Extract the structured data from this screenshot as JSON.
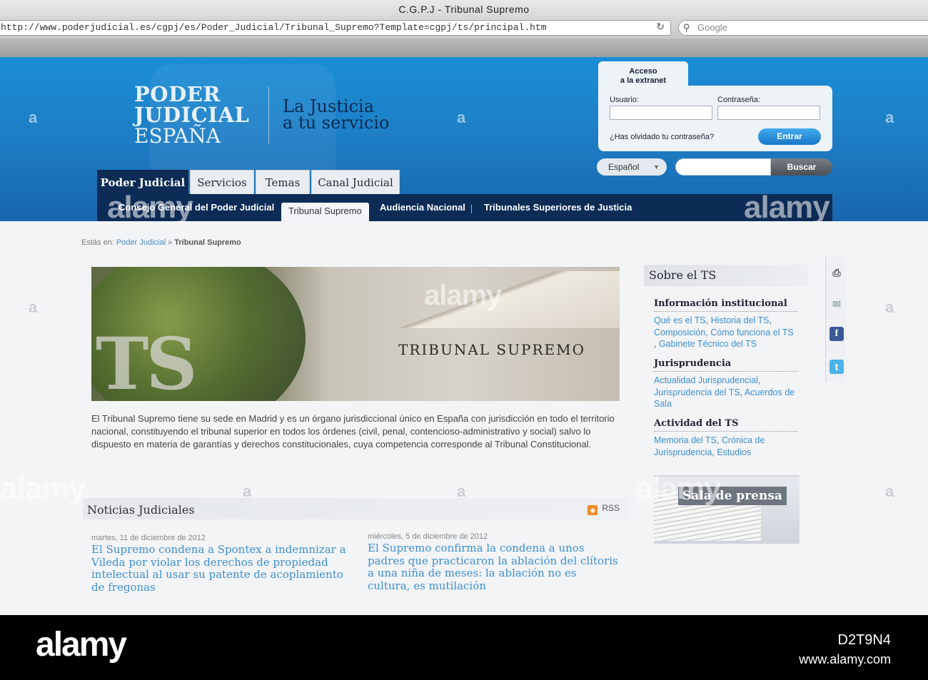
{
  "browser": {
    "window_title": "C.G.P.J - Tribunal Supremo",
    "url": "http://www.poderjudicial.es/cgpj/es/Poder_Judicial/Tribunal_Supremo?Template=cgpj/ts/principal.htm",
    "search_placeholder": "Google"
  },
  "header": {
    "logo_line1": "PODER",
    "logo_line2": "JUDICIAL",
    "logo_line3": "ESPAÑA",
    "tagline_line1": "La Justicia",
    "tagline_line2": "a tu servicio"
  },
  "login": {
    "tab_line1": "Acceso",
    "tab_line2": "a la extranet",
    "user_label": "Usuario:",
    "password_label": "Contraseña:",
    "forgot": "¿Has olvidado tu contraseña?",
    "submit": "Entrar"
  },
  "site_search": {
    "language": "Español",
    "button": "Buscar"
  },
  "main_tabs": [
    "Poder Judicial",
    "Servicios",
    "Temas",
    "Canal Judicial"
  ],
  "sub_nav": [
    "Consejo General del Poder Judicial",
    "Tribunal Supremo",
    "Audiencia Nacional",
    "Tribunales Superiores de Justicia"
  ],
  "breadcrumb": {
    "prefix": "Estás en:",
    "link": "Poder Judicial",
    "separator": "»",
    "current": "Tribunal Supremo"
  },
  "hero": {
    "inscription": "TRIBUNAL SUPREMO",
    "overlay": "TS"
  },
  "intro_text": "El Tribunal Supremo tiene su sede en Madrid  y es un órgano jurisdiccional único en España con jurisdicción en todo el territorio nacional, constituyendo el tribunal superior en todos los órdenes (civil, penal, contencioso-administrativo y social) salvo lo dispuesto en materia de garantías y derechos constitucionales, cuya competencia corresponde al Tribunal Constitucional.",
  "news": {
    "title": "Noticias Judiciales",
    "rss": "RSS",
    "items": [
      {
        "date": "martes, 11 de diciembre de 2012",
        "headline": "El Supremo condena a Spontex a indemnizar a Vileda por violar los derechos de propiedad intelectual al usar su patente de acoplamiento de fregonas"
      },
      {
        "date": "miércoles, 5 de diciembre de 2012",
        "headline": "El Supremo confirma la condena a unos padres que practicaron la ablación del clítoris a una niña de meses: la ablación no es cultura, es mutilación"
      }
    ]
  },
  "sidebar": {
    "title": "Sobre el TS",
    "sections": [
      {
        "title": "Información institucional",
        "links": [
          "Qué es el TS",
          "Historia del TS",
          "Composición",
          "Cómo funciona el TS",
          "Gabinete Técnico del TS"
        ]
      },
      {
        "title": "Jurisprudencia",
        "links": [
          "Actualidad Jurisprudencial",
          "Jurisprudencia del TS",
          "Acuerdos de Sala"
        ]
      },
      {
        "title": "Actividad del TS",
        "links": [
          "Memoria del TS",
          "Crónica de Jurisprudencia",
          "Estudios"
        ]
      }
    ],
    "press_room": "Sala de prensa"
  },
  "share_icons": [
    "print-icon",
    "email-icon",
    "facebook-icon",
    "twitter-icon"
  ],
  "colors": {
    "header_blue": "#1d7fc6",
    "nav_navy": "#0c2c55",
    "link_blue": "#3d8fd0",
    "facebook": "#3b5998",
    "twitter": "#4bb3e8",
    "rss_orange": "#f08a24"
  },
  "watermark": {
    "brand": "alamy",
    "image_id": "D2T9N4",
    "site": "www.alamy.com"
  }
}
